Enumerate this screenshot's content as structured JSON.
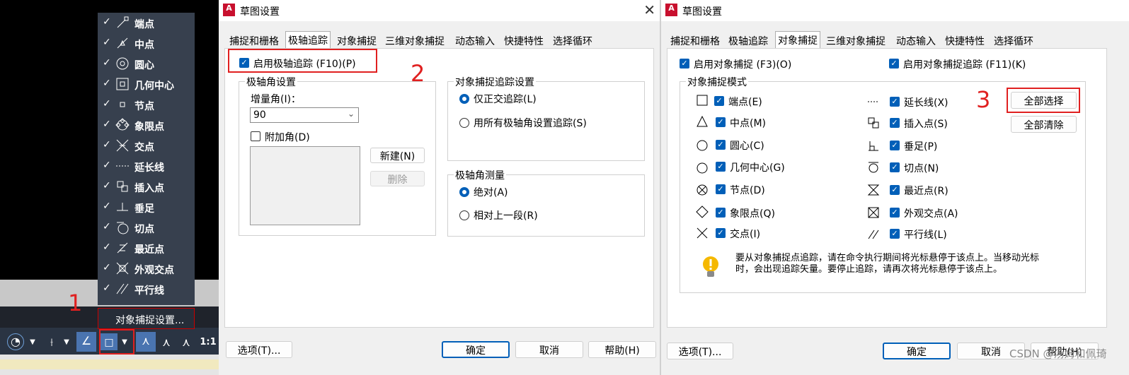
{
  "annotations": {
    "n1": "1",
    "n2": "2",
    "n3": "3"
  },
  "snap_menu": {
    "items": [
      {
        "label": "端点",
        "icon": "endpoint-icon"
      },
      {
        "label": "中点",
        "icon": "midpoint-icon"
      },
      {
        "label": "圆心",
        "icon": "center-icon"
      },
      {
        "label": "几何中心",
        "icon": "geometric-center-icon"
      },
      {
        "label": "节点",
        "icon": "node-icon"
      },
      {
        "label": "象限点",
        "icon": "quadrant-icon"
      },
      {
        "label": "交点",
        "icon": "intersection-icon"
      },
      {
        "label": "延长线",
        "icon": "extension-icon"
      },
      {
        "label": "插入点",
        "icon": "insertion-icon"
      },
      {
        "label": "垂足",
        "icon": "perpendicular-icon"
      },
      {
        "label": "切点",
        "icon": "tangent-icon"
      },
      {
        "label": "最近点",
        "icon": "nearest-icon"
      },
      {
        "label": "外观交点",
        "icon": "apparent-intersection-icon"
      },
      {
        "label": "平行线",
        "icon": "parallel-icon"
      }
    ],
    "settings_label": "对象捕捉设置..."
  },
  "statusbar": {
    "scale": "1:1"
  },
  "dialog1": {
    "title": "草图设置",
    "tabs": [
      "捕捉和栅格",
      "极轴追踪",
      "对象捕捉",
      "三维对象捕捉",
      "动态输入",
      "快捷特性",
      "选择循环"
    ],
    "active_tab": "极轴追踪",
    "enable_polar": "启用极轴追踪 (F10)(P)",
    "polar_angle_group": "极轴角设置",
    "increment_label": "增量角(I)：",
    "increment_value": "90",
    "additional_angle": "附加角(D)",
    "new_btn": "新建(N)",
    "delete_btn": "删除",
    "tracking_group": "对象捕捉追踪设置",
    "ortho_only": "仅正交追踪(L)",
    "all_polar": "用所有极轴角设置追踪(S)",
    "measure_group": "极轴角测量",
    "absolute": "绝对(A)",
    "relative": "相对上一段(R)",
    "options_btn": "选项(T)...",
    "ok_btn": "确定",
    "cancel_btn": "取消",
    "help_btn": "帮助(H)"
  },
  "dialog2": {
    "title": "草图设置",
    "tabs": [
      "捕捉和栅格",
      "极轴追踪",
      "对象捕捉",
      "三维对象捕捉",
      "动态输入",
      "快捷特性",
      "选择循环"
    ],
    "active_tab": "对象捕捉",
    "enable_osnap": "启用对象捕捉 (F3)(O)",
    "enable_tracking": "启用对象捕捉追踪 (F11)(K)",
    "modes_group": "对象捕捉模式",
    "left_modes": [
      {
        "label": "端点(E)",
        "icon": "square-icon"
      },
      {
        "label": "中点(M)",
        "icon": "triangle-icon"
      },
      {
        "label": "圆心(C)",
        "icon": "circle-icon"
      },
      {
        "label": "几何中心(G)",
        "icon": "circle-icon"
      },
      {
        "label": "节点(D)",
        "icon": "node-icon"
      },
      {
        "label": "象限点(Q)",
        "icon": "diamond-icon"
      },
      {
        "label": "交点(I)",
        "icon": "x-icon"
      }
    ],
    "right_modes": [
      {
        "label": "延长线(X)",
        "icon": "extension-icon"
      },
      {
        "label": "插入点(S)",
        "icon": "insertion-icon"
      },
      {
        "label": "垂足(P)",
        "icon": "perpendicular-icon"
      },
      {
        "label": "切点(N)",
        "icon": "tangent-icon"
      },
      {
        "label": "最近点(R)",
        "icon": "hourglass-icon"
      },
      {
        "label": "外观交点(A)",
        "icon": "boxed-x-icon"
      },
      {
        "label": "平行线(L)",
        "icon": "parallel-icon"
      }
    ],
    "select_all": "全部选择",
    "clear_all": "全部清除",
    "hint": "要从对象捕捉点追踪，请在命令执行期间将光标悬停于该点上。当移动光标时，会出现追踪矢量。要停止追踪，请再次将光标悬停于该点上。",
    "options_btn": "选项(T)...",
    "ok_btn": "确定",
    "cancel_btn": "取消",
    "help_btn": "帮助(H)"
  },
  "watermark": "CSDN @汤姆和佩琦"
}
